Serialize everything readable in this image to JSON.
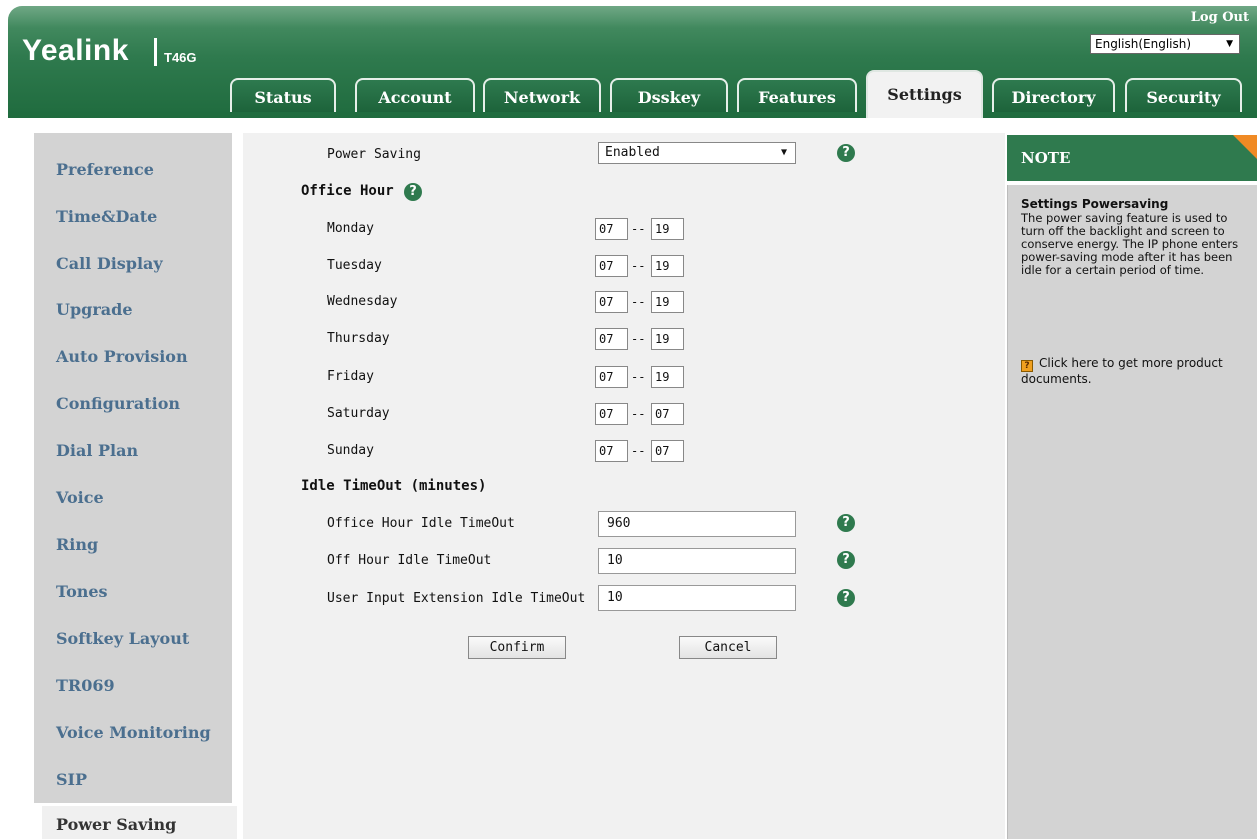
{
  "header": {
    "brand": "Yealink",
    "model": "T46G",
    "logout": "Log Out",
    "language": "English(English)"
  },
  "tabs": [
    {
      "label": "Status"
    },
    {
      "label": "Account"
    },
    {
      "label": "Network"
    },
    {
      "label": "Dsskey"
    },
    {
      "label": "Features"
    },
    {
      "label": "Settings",
      "active": true
    },
    {
      "label": "Directory"
    },
    {
      "label": "Security"
    }
  ],
  "sidebar": {
    "items": [
      "Preference",
      "Time&Date",
      "Call Display",
      "Upgrade",
      "Auto Provision",
      "Configuration",
      "Dial Plan",
      "Voice",
      "Ring",
      "Tones",
      "Softkey Layout",
      "TR069",
      "Voice Monitoring",
      "SIP"
    ],
    "active": "Power Saving"
  },
  "main": {
    "power_saving_label": "Power Saving",
    "power_saving_value": "Enabled",
    "office_hour_label": "Office Hour",
    "days": [
      {
        "day": "Monday",
        "start": "07",
        "end": "19"
      },
      {
        "day": "Tuesday",
        "start": "07",
        "end": "19"
      },
      {
        "day": "Wednesday",
        "start": "07",
        "end": "19"
      },
      {
        "day": "Thursday",
        "start": "07",
        "end": "19"
      },
      {
        "day": "Friday",
        "start": "07",
        "end": "19"
      },
      {
        "day": "Saturday",
        "start": "07",
        "end": "07"
      },
      {
        "day": "Sunday",
        "start": "07",
        "end": "07"
      }
    ],
    "separator": "--",
    "idle_label": "Idle TimeOut (minutes)",
    "idle": [
      {
        "label": "Office Hour Idle TimeOut",
        "value": "960"
      },
      {
        "label": "Off Hour Idle TimeOut",
        "value": "10"
      },
      {
        "label": "User Input Extension Idle TimeOut",
        "value": "10"
      }
    ],
    "confirm": "Confirm",
    "cancel": "Cancel",
    "help_glyph": "?"
  },
  "note": {
    "heading": "NOTE",
    "title": "Settings Powersaving",
    "text": "The power saving feature is used to turn off the backlight and screen to conserve energy. The IP phone enters power-saving mode after it has been idle for a certain period of time.",
    "doc_link": "Click here to get more product documents."
  },
  "colors": {
    "brand_green": "#2f7a4e",
    "sidebar_link": "#4b6f8f",
    "note_corner": "#f08a24"
  }
}
